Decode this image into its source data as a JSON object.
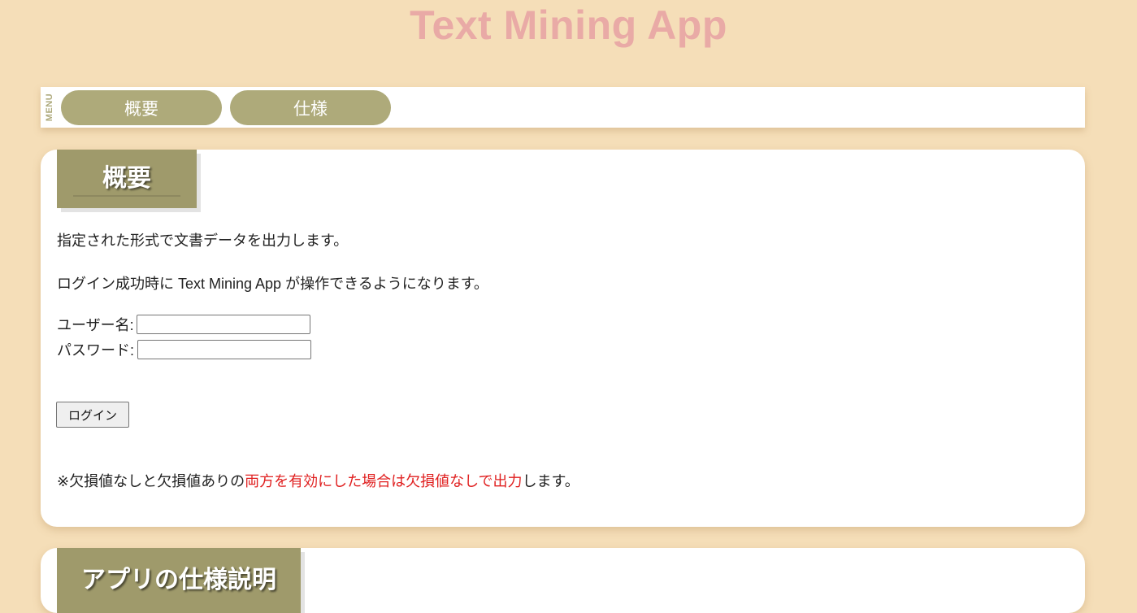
{
  "app": {
    "title": "Text Mining App"
  },
  "menu": {
    "label": "MENU",
    "items": [
      {
        "label": "概要"
      },
      {
        "label": "仕様"
      }
    ]
  },
  "overview": {
    "heading": "概要",
    "paragraphs": [
      "指定された形式で文書データを出力します。",
      "ログイン成功時に Text Mining App が操作できるようになります。"
    ],
    "form": {
      "username_label": "ユーザー名:",
      "username_value": "",
      "password_label": "パスワード:",
      "password_value": "",
      "login_button": "ログイン"
    },
    "note": {
      "prefix": "※欠損値なしと欠損値ありの",
      "highlight": "両方を有効にした場合は欠損値なしで出力",
      "suffix": "します。"
    }
  },
  "spec": {
    "heading": "アプリの仕様説明"
  },
  "colors": {
    "background": "#f5deb8",
    "title": "#e9aaa6",
    "menu_button": "#aeaa7a",
    "heading_box": "#9f9a6b",
    "note_highlight": "#e02020"
  }
}
